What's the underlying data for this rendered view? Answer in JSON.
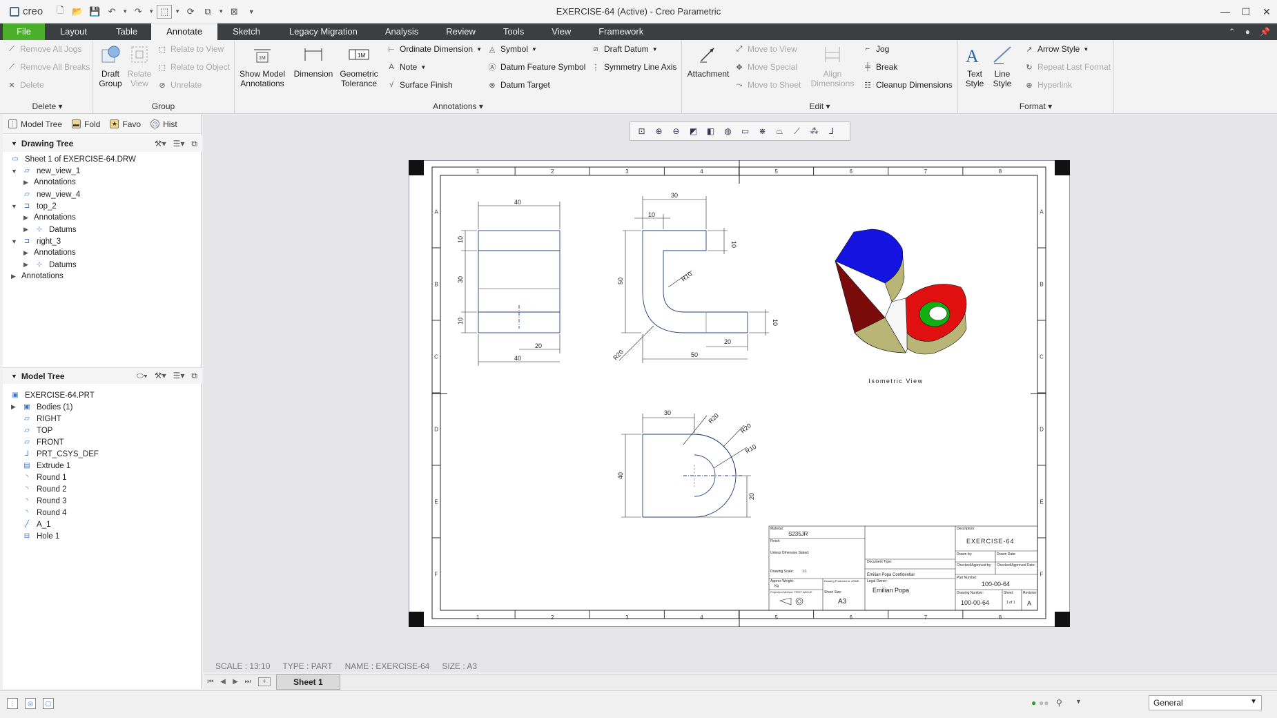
{
  "titlebar": {
    "logo": "creo",
    "title": "EXERCISE-64 (Active) - Creo Parametric"
  },
  "menu": {
    "tabs": [
      "File",
      "Layout",
      "Table",
      "Annotate",
      "Sketch",
      "Legacy Migration",
      "Analysis",
      "Review",
      "Tools",
      "View",
      "Framework"
    ],
    "active": "Annotate"
  },
  "ribbon": {
    "delete_group": {
      "items": [
        "Remove All Jogs",
        "Remove All Breaks",
        "Delete"
      ],
      "label": "Delete"
    },
    "group_group": {
      "draft_group": "Draft Group",
      "relate_view": "Relate View",
      "items": [
        "Relate to View",
        "Relate to Object",
        "Unrelate"
      ],
      "label": "Group"
    },
    "annotations": {
      "show_model": "Show Model Annotations",
      "dimension": "Dimension",
      "geo_tol": "Geometric Tolerance",
      "ordinate": "Ordinate Dimension",
      "note": "Note",
      "surface_finish": "Surface Finish",
      "symbol": "Symbol",
      "datum_feature": "Datum Feature Symbol",
      "datum_target": "Datum Target",
      "draft_datum": "Draft Datum",
      "symmetry": "Symmetry Line Axis",
      "label": "Annotations"
    },
    "edit": {
      "attachment": "Attachment",
      "move_view": "Move to View",
      "move_special": "Move Special",
      "move_sheet": "Move to Sheet",
      "align": "Align Dimensions",
      "jog": "Jog",
      "break": "Break",
      "cleanup": "Cleanup Dimensions",
      "label": "Edit"
    },
    "format": {
      "text_style": "Text Style",
      "line_style": "Line Style",
      "arrow_style": "Arrow Style",
      "repeat": "Repeat Last Format",
      "hyperlink": "Hyperlink",
      "label": "Format"
    }
  },
  "panel": {
    "tabs": [
      "Model Tree",
      "Fold",
      "Favo",
      "Hist"
    ],
    "drawing_tree": {
      "header": "Drawing Tree",
      "sheet": "Sheet 1 of EXERCISE-64.DRW",
      "nodes": [
        "new_view_1",
        "Annotations",
        "new_view_4",
        "top_2",
        "Annotations",
        "Datums",
        "right_3",
        "Annotations",
        "Datums",
        "Annotations"
      ]
    },
    "model_tree": {
      "header": "Model Tree",
      "root": "EXERCISE-64.PRT",
      "nodes": [
        "Bodies (1)",
        "RIGHT",
        "TOP",
        "FRONT",
        "PRT_CSYS_DEF",
        "Extrude 1",
        "Round 1",
        "Round 2",
        "Round 3",
        "Round 4",
        "A_1",
        "Hole 1"
      ]
    }
  },
  "drawing": {
    "zone_cols": [
      "1",
      "2",
      "3",
      "4",
      "5",
      "6",
      "7",
      "8"
    ],
    "zone_rows": [
      "A",
      "B",
      "C",
      "D",
      "E",
      "F"
    ],
    "front": {
      "d40_top": "40",
      "d10a": "10",
      "d30": "30",
      "d10b": "10",
      "d20": "20",
      "d40_bot": "40"
    },
    "side": {
      "d30": "30",
      "d10": "10",
      "d10r": "10",
      "d50": "50",
      "r10": "R10",
      "r20": "R20",
      "d20": "20",
      "d50b": "50",
      "d10b": "10"
    },
    "top": {
      "d30": "30",
      "r20a": "R20",
      "r20b": "R20",
      "r10": "R10",
      "d40": "40",
      "d20": "20"
    },
    "iso_label": "Isometric View",
    "title_block": {
      "material_label": "Material:",
      "material": "S235JR",
      "finish_label": "Finish:",
      "notes": "Unless Otherwise Stated:",
      "doc_type": "Document Type:",
      "conf": "Emilian Popa Confidential",
      "legal_owner": "Legal Owner:",
      "description_label": "Description:",
      "description": "EXERCISE-64",
      "drawn_by": "Drawn by:",
      "drawn_date": "Drawn Date:",
      "checked_by": "Checked/Approved by:",
      "checked_date": "Checked/Approved Date:",
      "part_number_label": "Part Number:",
      "part_number": "100-00-64",
      "author": "Emilian Popa",
      "drawing_number_label": "Drawing Number:",
      "drawing_number": "100-00-64",
      "sheet_label": "Sheet:",
      "sheet": "1 of 1",
      "revision_label": "Revision:",
      "revision": "A",
      "size_label": "Sheet Size:",
      "size": "A3",
      "approx_weight": "Approx Weight:",
      "weight": "Kg",
      "projection": "Projection Method: FIRST ANGLE",
      "produced": "Drawing Produced in: ASME",
      "drawing_scale": "Drawing Scale:",
      "scale_val": "1:1"
    }
  },
  "status": {
    "scale": "SCALE : 13:10",
    "type": "TYPE : PART",
    "name": "NAME : EXERCISE-64",
    "size": "SIZE : A3"
  },
  "sheet_tab": "Sheet 1",
  "filter": "General",
  "colors": {
    "file_tab": "#4caf2c",
    "menubar": "#3c3f41",
    "drawing_line": "#1f3e7a",
    "iso_blue": "#1414e0",
    "iso_red": "#e01010",
    "iso_dark": "#7a0b0b",
    "iso_green": "#10b010",
    "iso_tan": "#b9b577"
  }
}
